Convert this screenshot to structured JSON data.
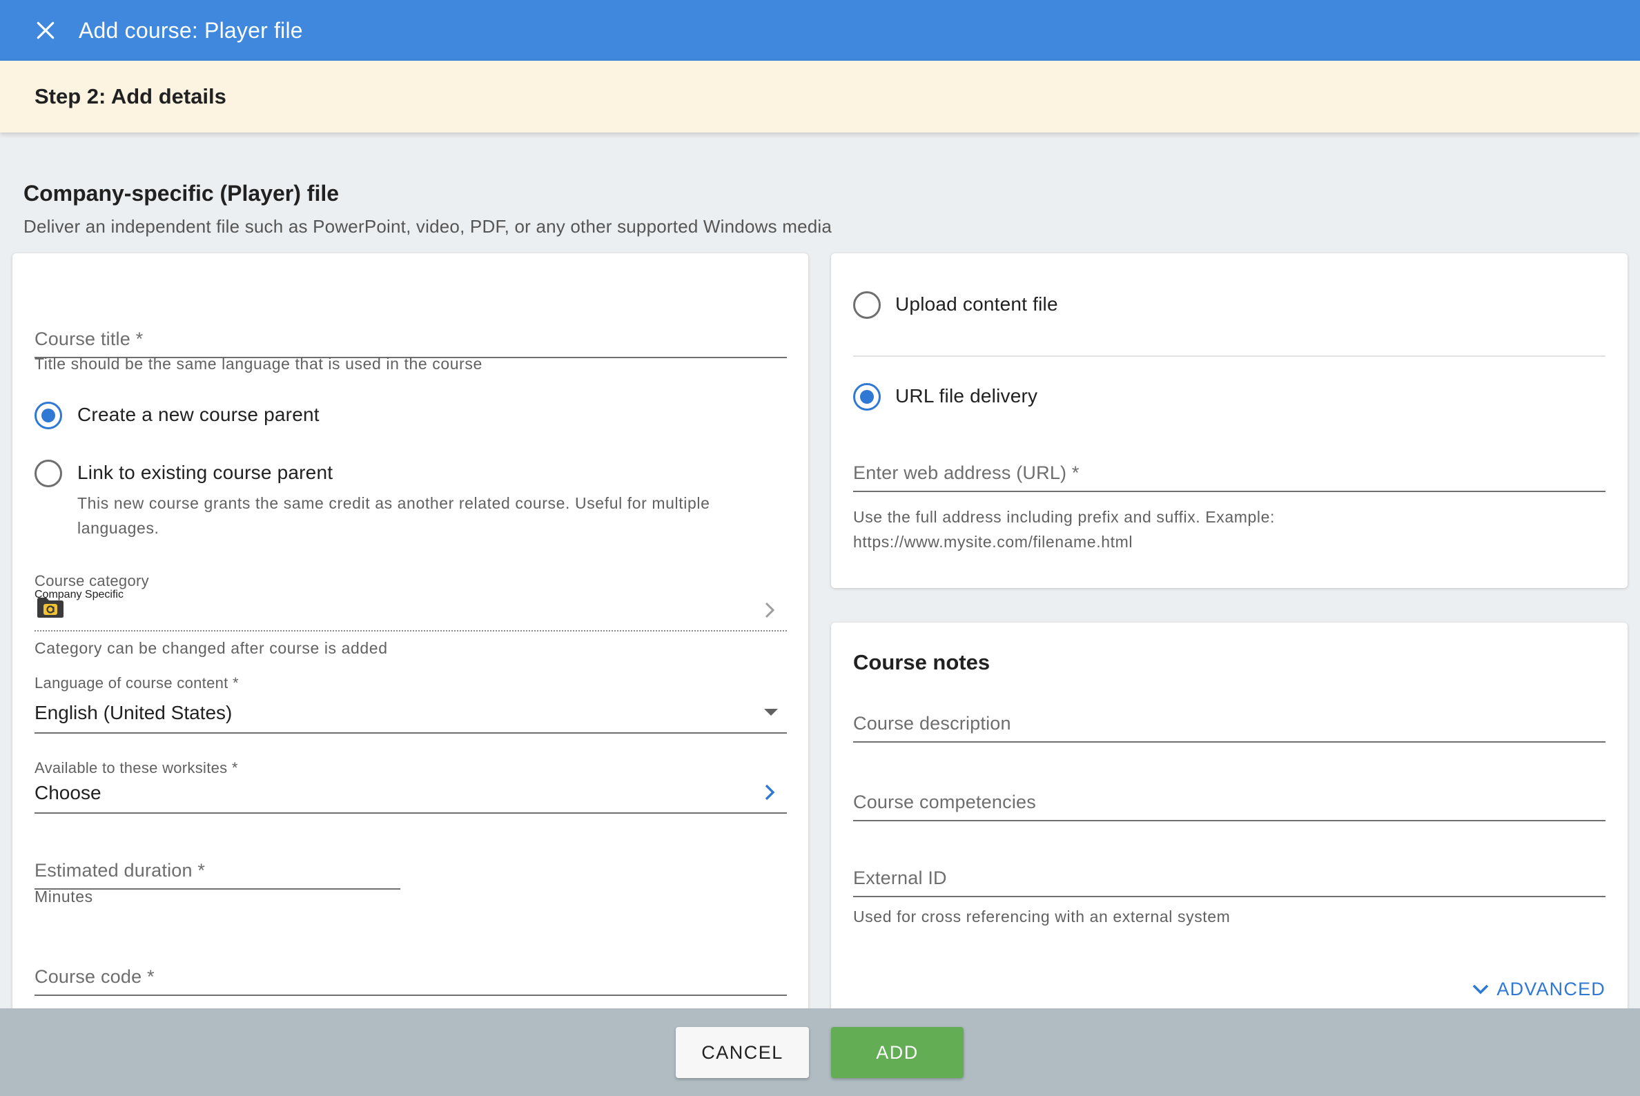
{
  "header": {
    "title": "Add course: Player file",
    "close_icon": "close-icon",
    "color": "#3f88dd"
  },
  "step": {
    "label": "Step 2: Add details"
  },
  "section": {
    "title": "Company-specific (Player) file",
    "subtitle": "Deliver an independent file such as PowerPoint, video, PDF, or any other supported Windows media"
  },
  "left_card": {
    "course_title": {
      "placeholder": "Course title *",
      "value": "",
      "hint": "Title should be the same language that is used in the course"
    },
    "parent_options": [
      {
        "label": "Create a new course parent",
        "checked": true
      },
      {
        "label": "Link to existing course parent",
        "checked": false,
        "hint": "This new course grants the same credit as another related course. Useful for multiple languages."
      }
    ],
    "category": {
      "label": "Course category",
      "value": "Company Specific",
      "hint": "Category can be changed after course is added",
      "icon": "folder-icon"
    },
    "language": {
      "label": "Language of course content *",
      "value": "English (United States)"
    },
    "worksites": {
      "label": "Available to these worksites *",
      "value": "Choose"
    },
    "duration": {
      "placeholder": "Estimated duration *",
      "hint": "Minutes"
    },
    "course_code": {
      "placeholder": "Course code *"
    }
  },
  "right_top_card": {
    "options": [
      {
        "label": "Upload content file",
        "checked": false
      },
      {
        "label": "URL file delivery",
        "checked": true
      }
    ],
    "url": {
      "placeholder": "Enter web address (URL) *",
      "hint_line1": "Use the full address including prefix and suffix. Example:",
      "hint_line2": "https://www.mysite.com/filename.html"
    }
  },
  "right_bottom_card": {
    "title": "Course notes",
    "description": {
      "placeholder": "Course description"
    },
    "competencies": {
      "placeholder": "Course competencies"
    },
    "external_id": {
      "placeholder": "External ID",
      "hint": "Used for cross referencing with an external system"
    },
    "advanced_label": "ADVANCED"
  },
  "footer": {
    "cancel_label": "CANCEL",
    "add_label": "ADD",
    "add_color": "#63ad55"
  }
}
